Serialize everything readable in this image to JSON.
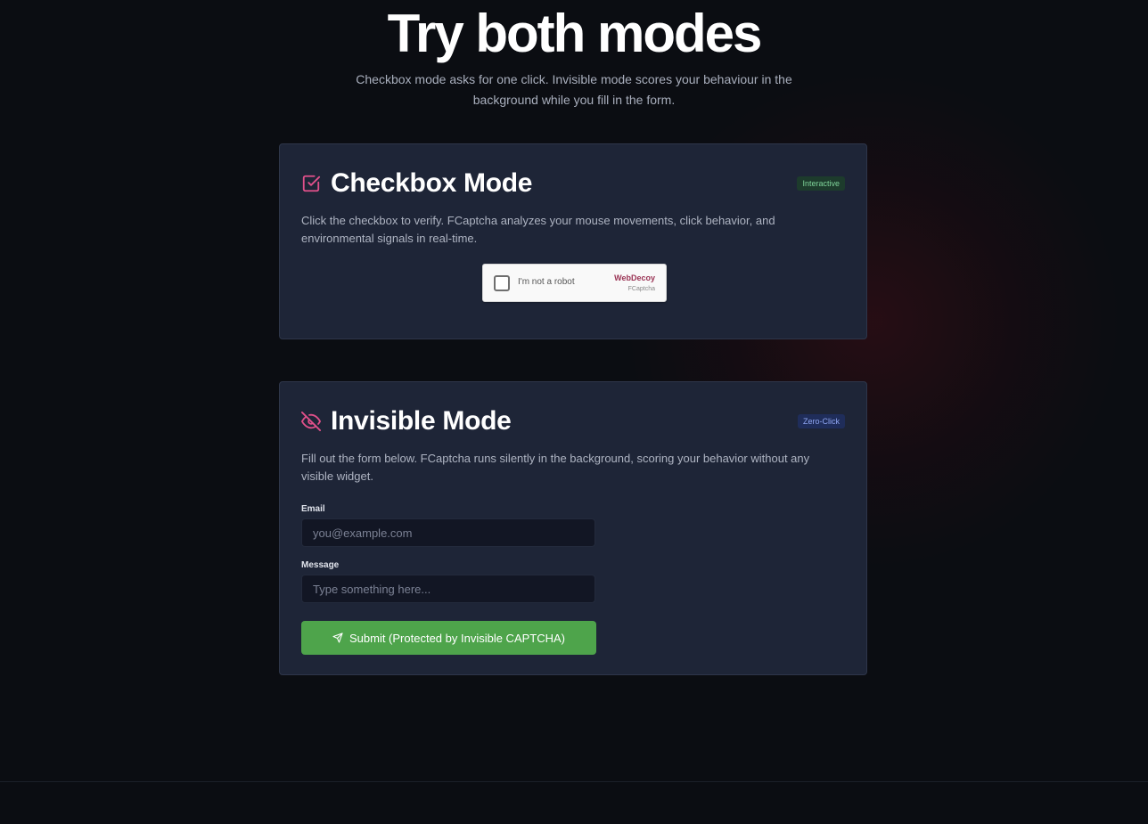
{
  "hero": {
    "title": "Try both modes",
    "subtitle": "Checkbox mode asks for one click. Invisible mode scores your behaviour in the background while you fill in the form."
  },
  "checkbox_mode": {
    "icon": "check-square-icon",
    "title": "Checkbox Mode",
    "badge": "Interactive",
    "description": "Click the checkbox to verify. FCaptcha analyzes your mouse movements, click behavior, and environmental signals in real-time.",
    "widget": {
      "label": "I'm not a robot",
      "brand": "WebDecoy",
      "sub_brand": "FCaptcha",
      "checked": false
    }
  },
  "invisible_mode": {
    "icon": "eye-off-icon",
    "title": "Invisible Mode",
    "badge": "Zero-Click",
    "description": "Fill out the form below. FCaptcha runs silently in the background, scoring your behavior without any visible widget.",
    "email_label": "Email",
    "email_placeholder": "you@example.com",
    "email_value": "",
    "message_label": "Message",
    "message_placeholder": "Type something here...",
    "message_value": "",
    "submit_icon": "send-icon",
    "submit_label": "Submit (Protected by Invisible CAPTCHA)"
  },
  "colors": {
    "background": "#0b0d12",
    "card": "#1e2537",
    "accent_pink": "#e0508a",
    "submit_green": "#4ea44b",
    "badge_green_text": "#7fd49a",
    "badge_blue_text": "#8fa6f2"
  }
}
